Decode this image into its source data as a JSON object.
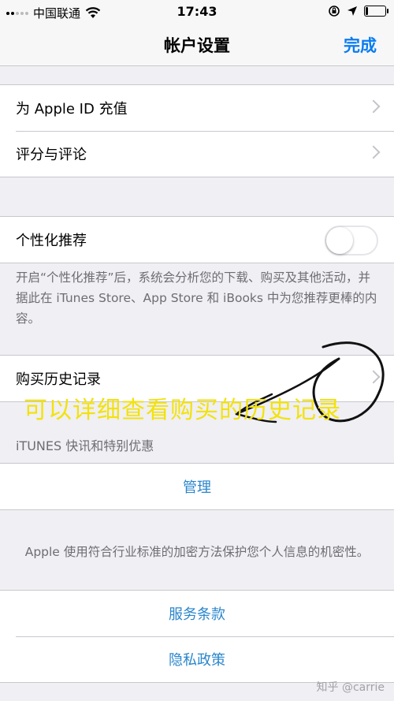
{
  "status_bar": {
    "carrier": "中国联通",
    "time": "17:43",
    "wifi_icon": "wifi-icon",
    "lock_rotation_icon": "rotation-lock-icon",
    "location_icon": "location-arrow-icon",
    "battery_icon": "battery-icon",
    "battery_level": 0.15
  },
  "nav": {
    "title": "帐户设置",
    "done_label": "完成",
    "accent_color": "#0a7cf2"
  },
  "section1": {
    "items": [
      {
        "label": "为 Apple ID 充值"
      },
      {
        "label": "评分与评论"
      }
    ]
  },
  "section2": {
    "toggle_label": "个性化推荐",
    "toggle_on": false,
    "footnote": "开启“个性化推荐”后，系统会分析您的下载、购买及其他活动，并据此在 iTunes Store、App Store 和 iBooks 中为您推荐更棒的内容。"
  },
  "section3": {
    "purchase_history_label": "购买历史记录",
    "annotation": "可以详细查看购买的历史记录"
  },
  "section4": {
    "header": "iTUNES 快讯和特别优惠",
    "manage_label": "管理",
    "security_note": "Apple 使用符合行业标准的加密方法保护您个人信息的机密性。"
  },
  "section5": {
    "terms_label": "服务条款",
    "privacy_label": "隐私政策",
    "link_color": "#2a86cc"
  },
  "watermark": "知乎 @carrie"
}
